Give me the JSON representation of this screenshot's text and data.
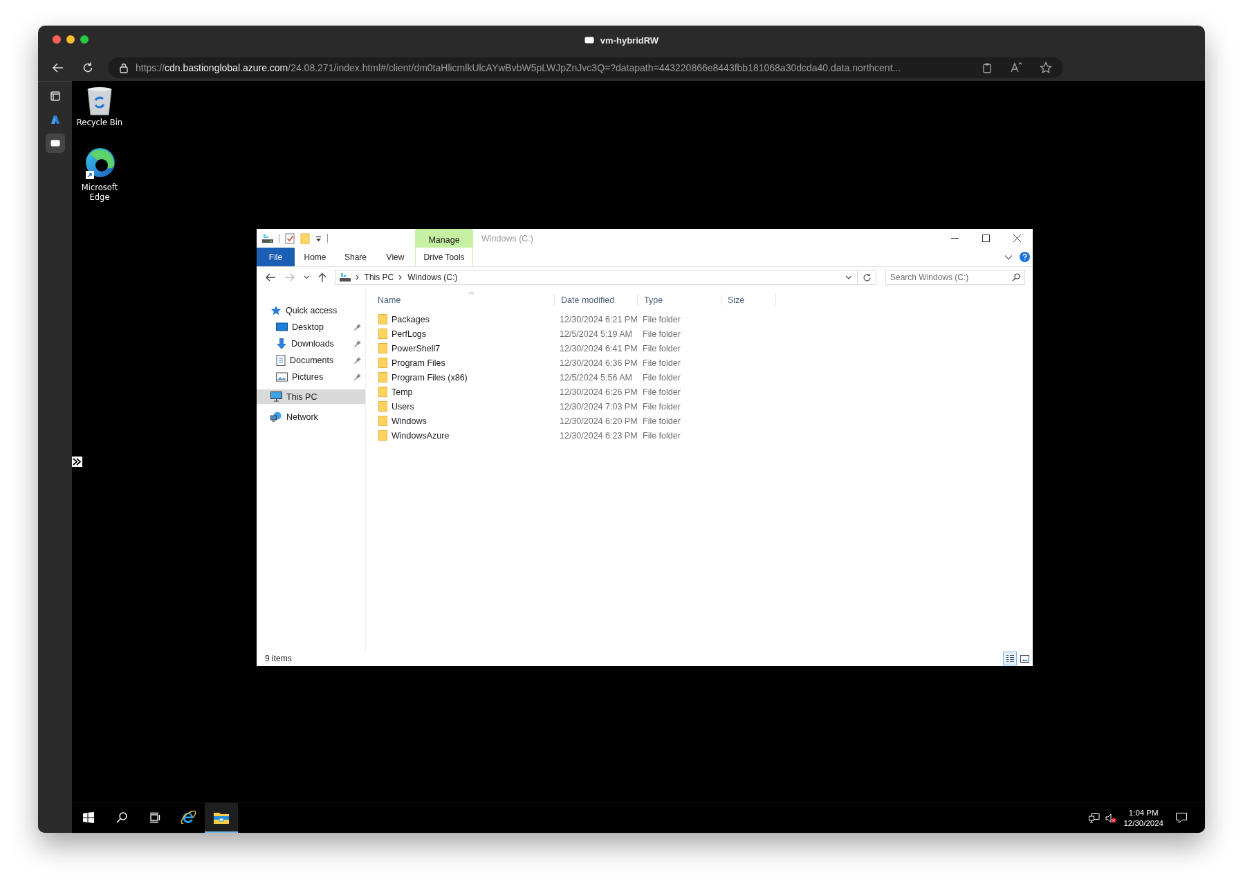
{
  "browser": {
    "title": "vm-hybridRW",
    "url": "https://**cdn.bastionglobal.azure.com**/24.08.271/index.html#/client/dm0taHlicmlkUlcAYwBvbW5pLWJpZnJvc3Q=?datapath=443220866e8443fbb181068a30dcda40.data.northcent...",
    "sidebar_tabs": [
      {
        "kind": "window",
        "selected": false
      },
      {
        "kind": "azure",
        "selected": false
      },
      {
        "kind": "bastion",
        "selected": true
      }
    ]
  },
  "desktop_icons": [
    {
      "label": "Recycle Bin",
      "kind": "recycle"
    },
    {
      "label": "Microsoft Edge",
      "kind": "edge"
    }
  ],
  "explorer": {
    "title": "Windows (C:)",
    "context_group": "Manage",
    "ribbon_tabs": [
      {
        "label": "File",
        "kind": "file"
      },
      {
        "label": "Home",
        "kind": "plain"
      },
      {
        "label": "Share",
        "kind": "plain"
      },
      {
        "label": "View",
        "kind": "plain"
      },
      {
        "label": "Drive Tools",
        "kind": "contextual"
      }
    ],
    "breadcrumbs": [
      "This PC",
      "Windows (C:)"
    ],
    "search": {
      "placeholder": "Search Windows (C:)"
    },
    "navigation": [
      {
        "label": "Quick access",
        "kind": "star",
        "selected": false,
        "children": [
          {
            "label": "Desktop",
            "kind": "desktop",
            "pinned": true,
            "selected": false
          },
          {
            "label": "Downloads",
            "kind": "downloads",
            "pinned": true,
            "selected": false
          },
          {
            "label": "Documents",
            "kind": "documents",
            "pinned": true,
            "selected": false
          },
          {
            "label": "Pictures",
            "kind": "pictures",
            "pinned": true,
            "selected": false
          }
        ]
      },
      {
        "label": "This PC",
        "kind": "pc",
        "selected": true
      },
      {
        "label": "Network",
        "kind": "network",
        "selected": false
      }
    ],
    "columns": [
      "Name",
      "Date modified",
      "Type",
      "Size"
    ],
    "rows": [
      {
        "name": "Packages",
        "date": "12/30/2024 6:21 PM",
        "type": "File folder"
      },
      {
        "name": "PerfLogs",
        "date": "12/5/2024 5:19 AM",
        "type": "File folder"
      },
      {
        "name": "PowerShell7",
        "date": "12/30/2024 6:41 PM",
        "type": "File folder"
      },
      {
        "name": "Program Files",
        "date": "12/30/2024 6:36 PM",
        "type": "File folder"
      },
      {
        "name": "Program Files (x86)",
        "date": "12/5/2024 5:56 AM",
        "type": "File folder"
      },
      {
        "name": "Temp",
        "date": "12/30/2024 6:26 PM",
        "type": "File folder"
      },
      {
        "name": "Users",
        "date": "12/30/2024 7:03 PM",
        "type": "File folder"
      },
      {
        "name": "Windows",
        "date": "12/30/2024 6:20 PM",
        "type": "File folder"
      },
      {
        "name": "WindowsAzure",
        "date": "12/30/2024 6:23 PM",
        "type": "File folder"
      }
    ],
    "status": "9 items",
    "view_buttons": [
      {
        "kind": "details",
        "selected": true
      },
      {
        "kind": "large_icons",
        "selected": false
      }
    ]
  },
  "taskbar": {
    "apps": [
      {
        "kind": "start",
        "active": false
      },
      {
        "kind": "search",
        "active": false
      },
      {
        "kind": "taskview",
        "active": false
      },
      {
        "kind": "ie",
        "active": false
      },
      {
        "kind": "explorer",
        "active": true
      }
    ],
    "volume_muted": true,
    "time": "1:04 PM",
    "date": "12/30/2024"
  }
}
